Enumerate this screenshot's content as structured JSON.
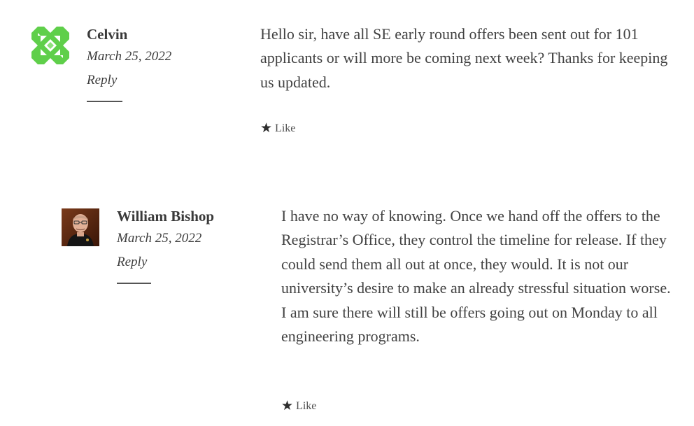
{
  "comments": [
    {
      "author": "Celvin",
      "date": "March 25, 2022",
      "reply_label": "Reply",
      "text": "Hello sir, have all SE early round offers been sent out for 101 applicants or will more be coming next week? Thanks for keeping us updated.",
      "like_label": "Like",
      "avatar_icon": "identicon-avatar",
      "avatar_color": "#5fcf4a"
    },
    {
      "author": "William Bishop",
      "date": "March 25, 2022",
      "reply_label": "Reply",
      "text": "I have no way of knowing. Once we hand off the offers to the Registrar’s Office, they control the timeline for release. If they could send them all out at once, they would. It is not our university’s desire to make an already stressful situation worse. I am sure there will still be offers going out on Monday to all engineering programs.",
      "like_label": "Like",
      "avatar_icon": "user-photo-avatar"
    }
  ]
}
